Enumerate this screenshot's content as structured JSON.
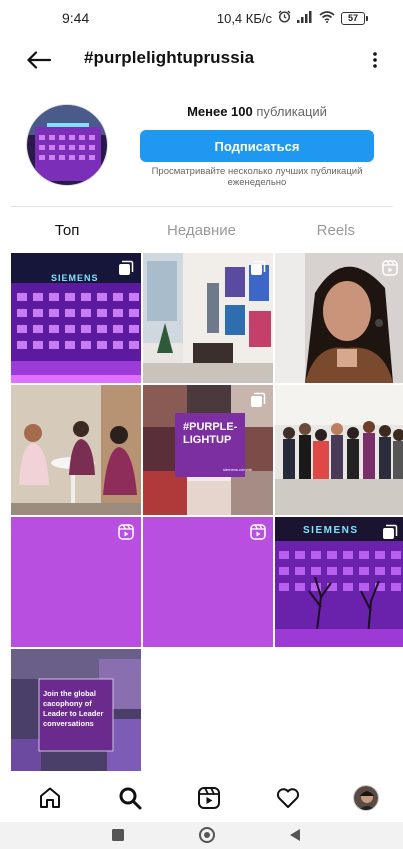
{
  "status_bar": {
    "time": "9:44",
    "net_speed": "10,4 КБ/с",
    "battery": "57",
    "icons": [
      "alarm-icon",
      "signal-icon",
      "wifi-icon",
      "battery-icon"
    ]
  },
  "header": {
    "title": "#purplelightuprussia",
    "back_icon": "back-arrow-icon",
    "more_icon": "more-vertical-icon"
  },
  "profile": {
    "post_count_bold": "Менее 100",
    "post_count_rest": " публикаций",
    "follow_label": "Подписаться",
    "follow_note": "Просматривайте несколько лучших публикаций еженедельно"
  },
  "tabs": [
    {
      "label": "Топ",
      "active": true
    },
    {
      "label": "Недавние",
      "active": false
    },
    {
      "label": "Reels",
      "active": false
    }
  ],
  "grid": {
    "tiles": [
      {
        "kind": "siemens-building",
        "badge": "carousel-icon"
      },
      {
        "kind": "office-gallery",
        "badge": "carousel-icon"
      },
      {
        "kind": "selfie",
        "badge": "reels-icon"
      },
      {
        "kind": "meeting",
        "badge": ""
      },
      {
        "kind": "collage",
        "badge": "carousel-icon",
        "text": "#PURPLE-\nLIGHTUP",
        "url": "siemens.com/de"
      },
      {
        "kind": "group",
        "badge": ""
      },
      {
        "kind": "purple",
        "badge": "reels-icon"
      },
      {
        "kind": "purple",
        "badge": "reels-icon"
      },
      {
        "kind": "siemens-night",
        "badge": "carousel-icon"
      },
      {
        "kind": "leader-promo",
        "badge": "",
        "text": "Join the global\ncacophony of\nLeader to Leader\nconversations"
      }
    ],
    "siemens_label": "SIEMENS",
    "purple_tile_color": "#b84fe0"
  },
  "bottom_nav": {
    "items": [
      "home-icon",
      "search-icon",
      "reels-icon",
      "heart-icon",
      "profile-avatar"
    ]
  },
  "system_nav": {
    "items": [
      "recents-square-icon",
      "home-circle-icon",
      "back-triangle-icon"
    ]
  },
  "colors": {
    "accent": "#1f98f2",
    "purple": "#b84fe0"
  }
}
